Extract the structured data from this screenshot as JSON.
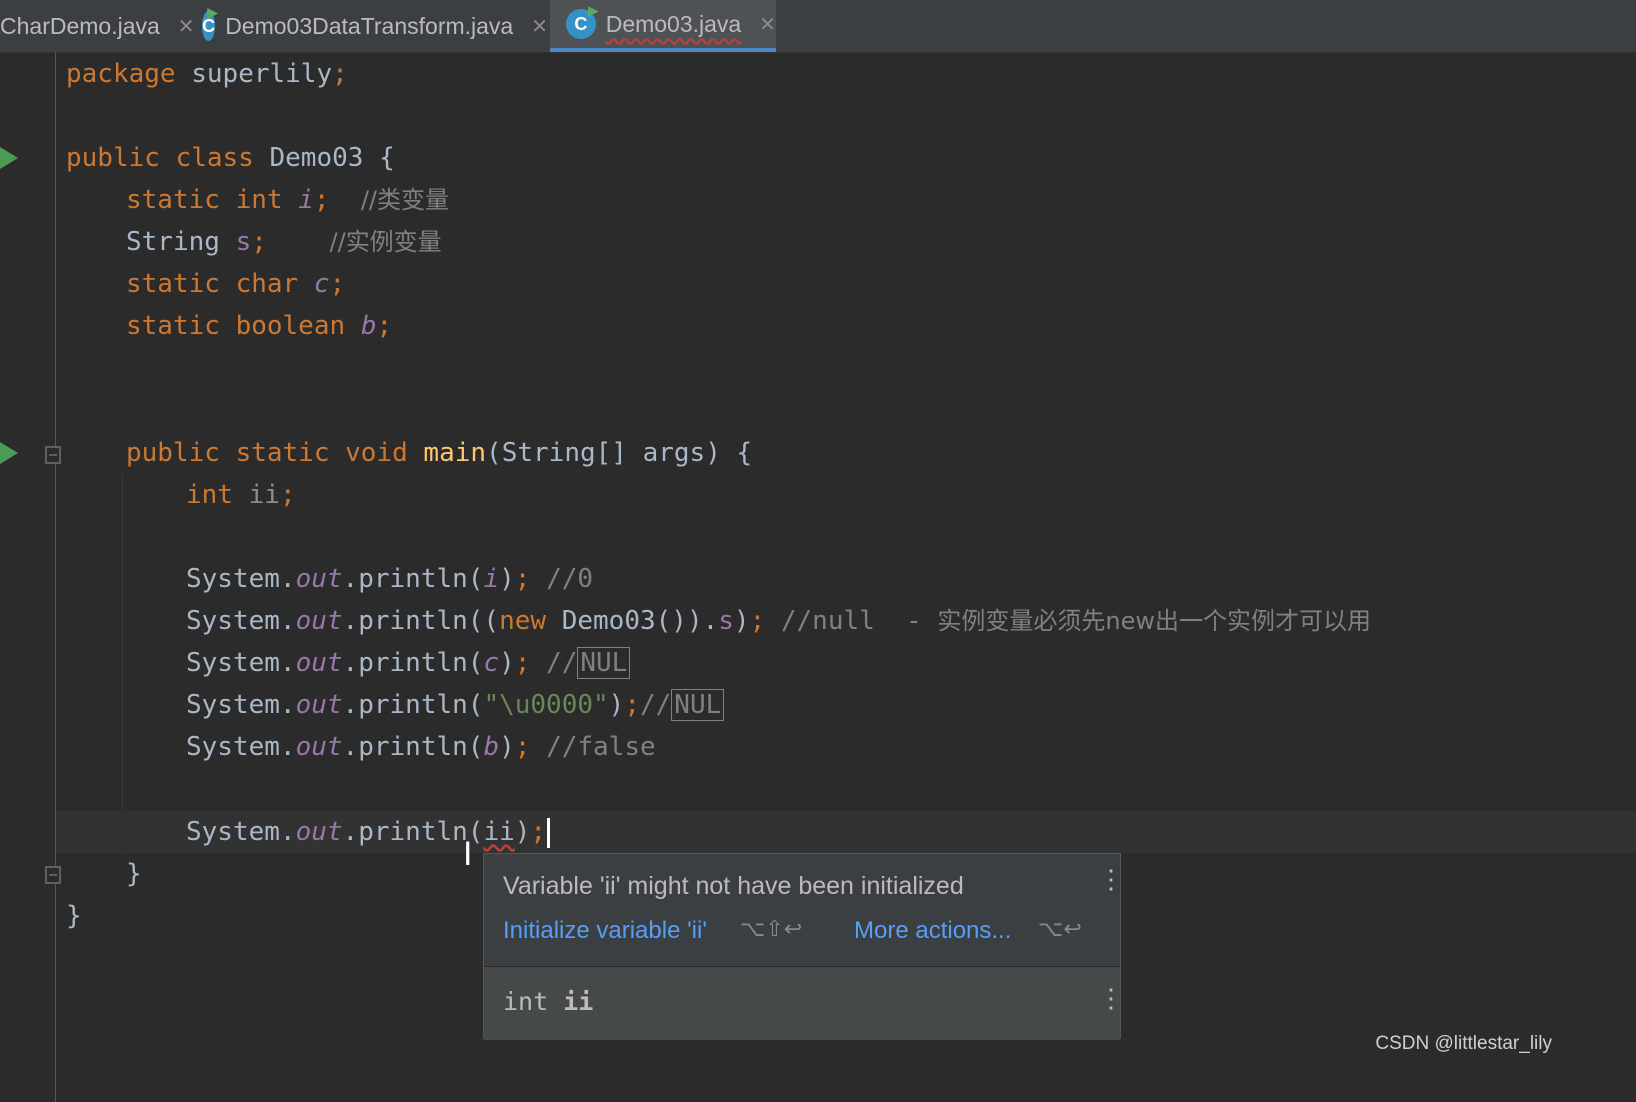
{
  "tabs": [
    {
      "label": "CharDemo.java",
      "active": false
    },
    {
      "label": "Demo03DataTransform.java",
      "active": false
    },
    {
      "label": "Demo03.java",
      "active": true
    }
  ],
  "code": {
    "l1": {
      "kw": "package",
      "name": " superlily",
      "semi": ";"
    },
    "l3": {
      "kw": "public class",
      "name": " Demo03 {"
    },
    "l4": {
      "kw": "static int",
      "var": "i",
      "semi": ";",
      "cmt": "//类变量"
    },
    "l5": {
      "type": "String",
      "var": "s",
      "semi": ";",
      "cmt": "//实例变量"
    },
    "l6": {
      "kw": "static char",
      "var": "c",
      "semi": ";"
    },
    "l7": {
      "kw": "static boolean",
      "var": "b",
      "semi": ";"
    },
    "l10": {
      "kw": "public static void",
      "method": "main",
      "rest": "(String[] args) {"
    },
    "l11": {
      "kw": "int",
      "var": "ii",
      "semi": ";"
    },
    "sys": "System",
    "out": "out",
    "println": "println",
    "l13": {
      "arg": "i",
      "cmt": "//0"
    },
    "l14": {
      "kwnew": "new",
      "cls": " Demo03()).",
      "field": "s",
      "cmt": "//null  - ",
      "cmt_cn": "实例变量必须先new出一个实例才可以用"
    },
    "l15": {
      "arg": "c",
      "cmt": "//",
      "nul": "NUL"
    },
    "l16": {
      "str": "\"\\u0000\"",
      "cmt": "//",
      "nul": "NUL"
    },
    "l17": {
      "arg": "b",
      "cmt": "//false"
    },
    "l19": {
      "arg": "ii"
    },
    "close_method": "}",
    "close_class": "}"
  },
  "popup": {
    "message": "Variable 'ii' might not have been initialized",
    "action1": "Initialize variable 'ii'",
    "shortcut1": "⌥⇧↩",
    "action2": "More actions...",
    "shortcut2": "⌥↩",
    "decl_type": "int",
    "decl_name": "ii"
  },
  "watermark": "CSDN @littlestar_lily",
  "colors": {
    "background": "#2b2b2b",
    "keyword": "#cc7832",
    "field": "#9876aa",
    "method": "#ffc66d",
    "string": "#6a8759",
    "comment": "#808080",
    "link": "#589df6",
    "run": "#499c54"
  }
}
